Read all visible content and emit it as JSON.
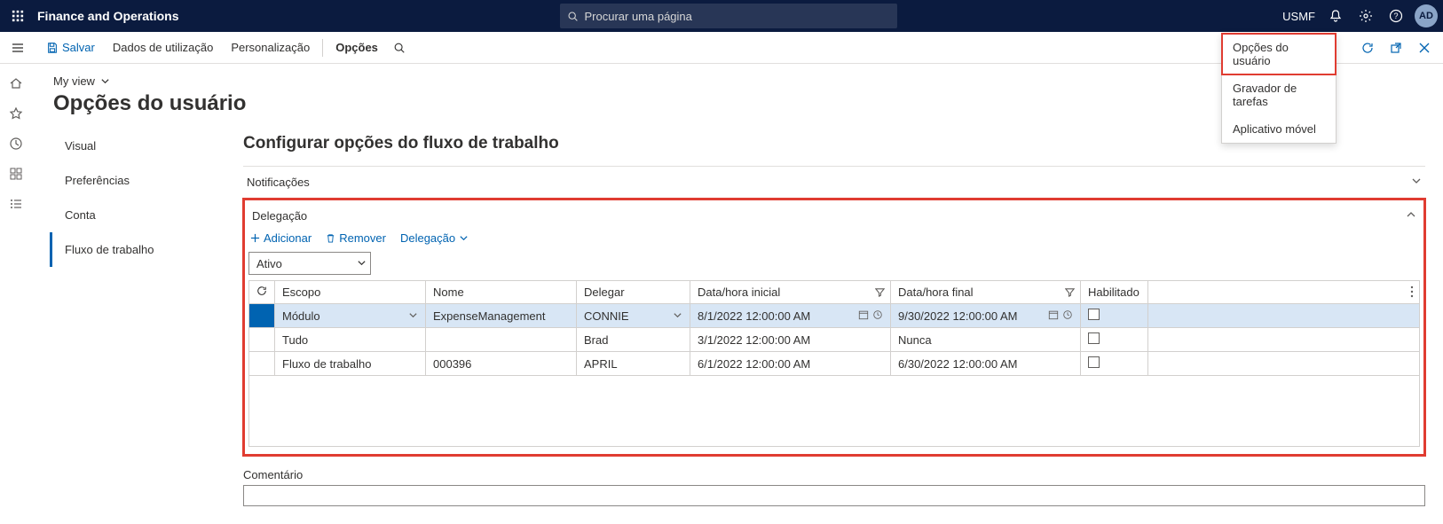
{
  "topbar": {
    "brand": "Finance and Operations",
    "search_placeholder": "Procurar uma página",
    "company": "USMF",
    "avatar": "AD"
  },
  "cmdbar": {
    "save": "Salvar",
    "data_usage": "Dados de utilização",
    "personalize": "Personalização",
    "options": "Opções"
  },
  "settings_menu": {
    "user_options": "Opções do usuário",
    "task_recorder": "Gravador de tarefas",
    "mobile_app": "Aplicativo móvel"
  },
  "breadcrumb": {
    "label": "My view"
  },
  "page": {
    "title": "Opções do usuário"
  },
  "sidenav": {
    "visual": "Visual",
    "preferences": "Preferências",
    "account": "Conta",
    "workflow": "Fluxo de trabalho"
  },
  "workflow": {
    "section_title": "Configurar opções do fluxo de trabalho",
    "notifications": "Notificações",
    "delegation": "Delegação",
    "actions": {
      "add": "Adicionar",
      "remove": "Remover",
      "delegation_dd": "Delegação"
    },
    "filter": {
      "value": "Ativo"
    },
    "columns": {
      "scope": "Escopo",
      "name": "Nome",
      "delegate": "Delegar",
      "start": "Data/hora inicial",
      "end": "Data/hora final",
      "enabled": "Habilitado"
    },
    "rows": [
      {
        "scope": "Módulo",
        "name": "ExpenseManagement",
        "delegate": "CONNIE",
        "start": "8/1/2022 12:00:00 AM",
        "end": "9/30/2022 12:00:00 AM",
        "selected": true
      },
      {
        "scope": "Tudo",
        "name": "",
        "delegate": "Brad",
        "start": "3/1/2022 12:00:00 AM",
        "end": "Nunca"
      },
      {
        "scope": "Fluxo de trabalho",
        "name": "000396",
        "delegate": "APRIL",
        "start": "6/1/2022 12:00:00 AM",
        "end": "6/30/2022 12:00:00 AM"
      }
    ],
    "comment_label": "Comentário"
  }
}
